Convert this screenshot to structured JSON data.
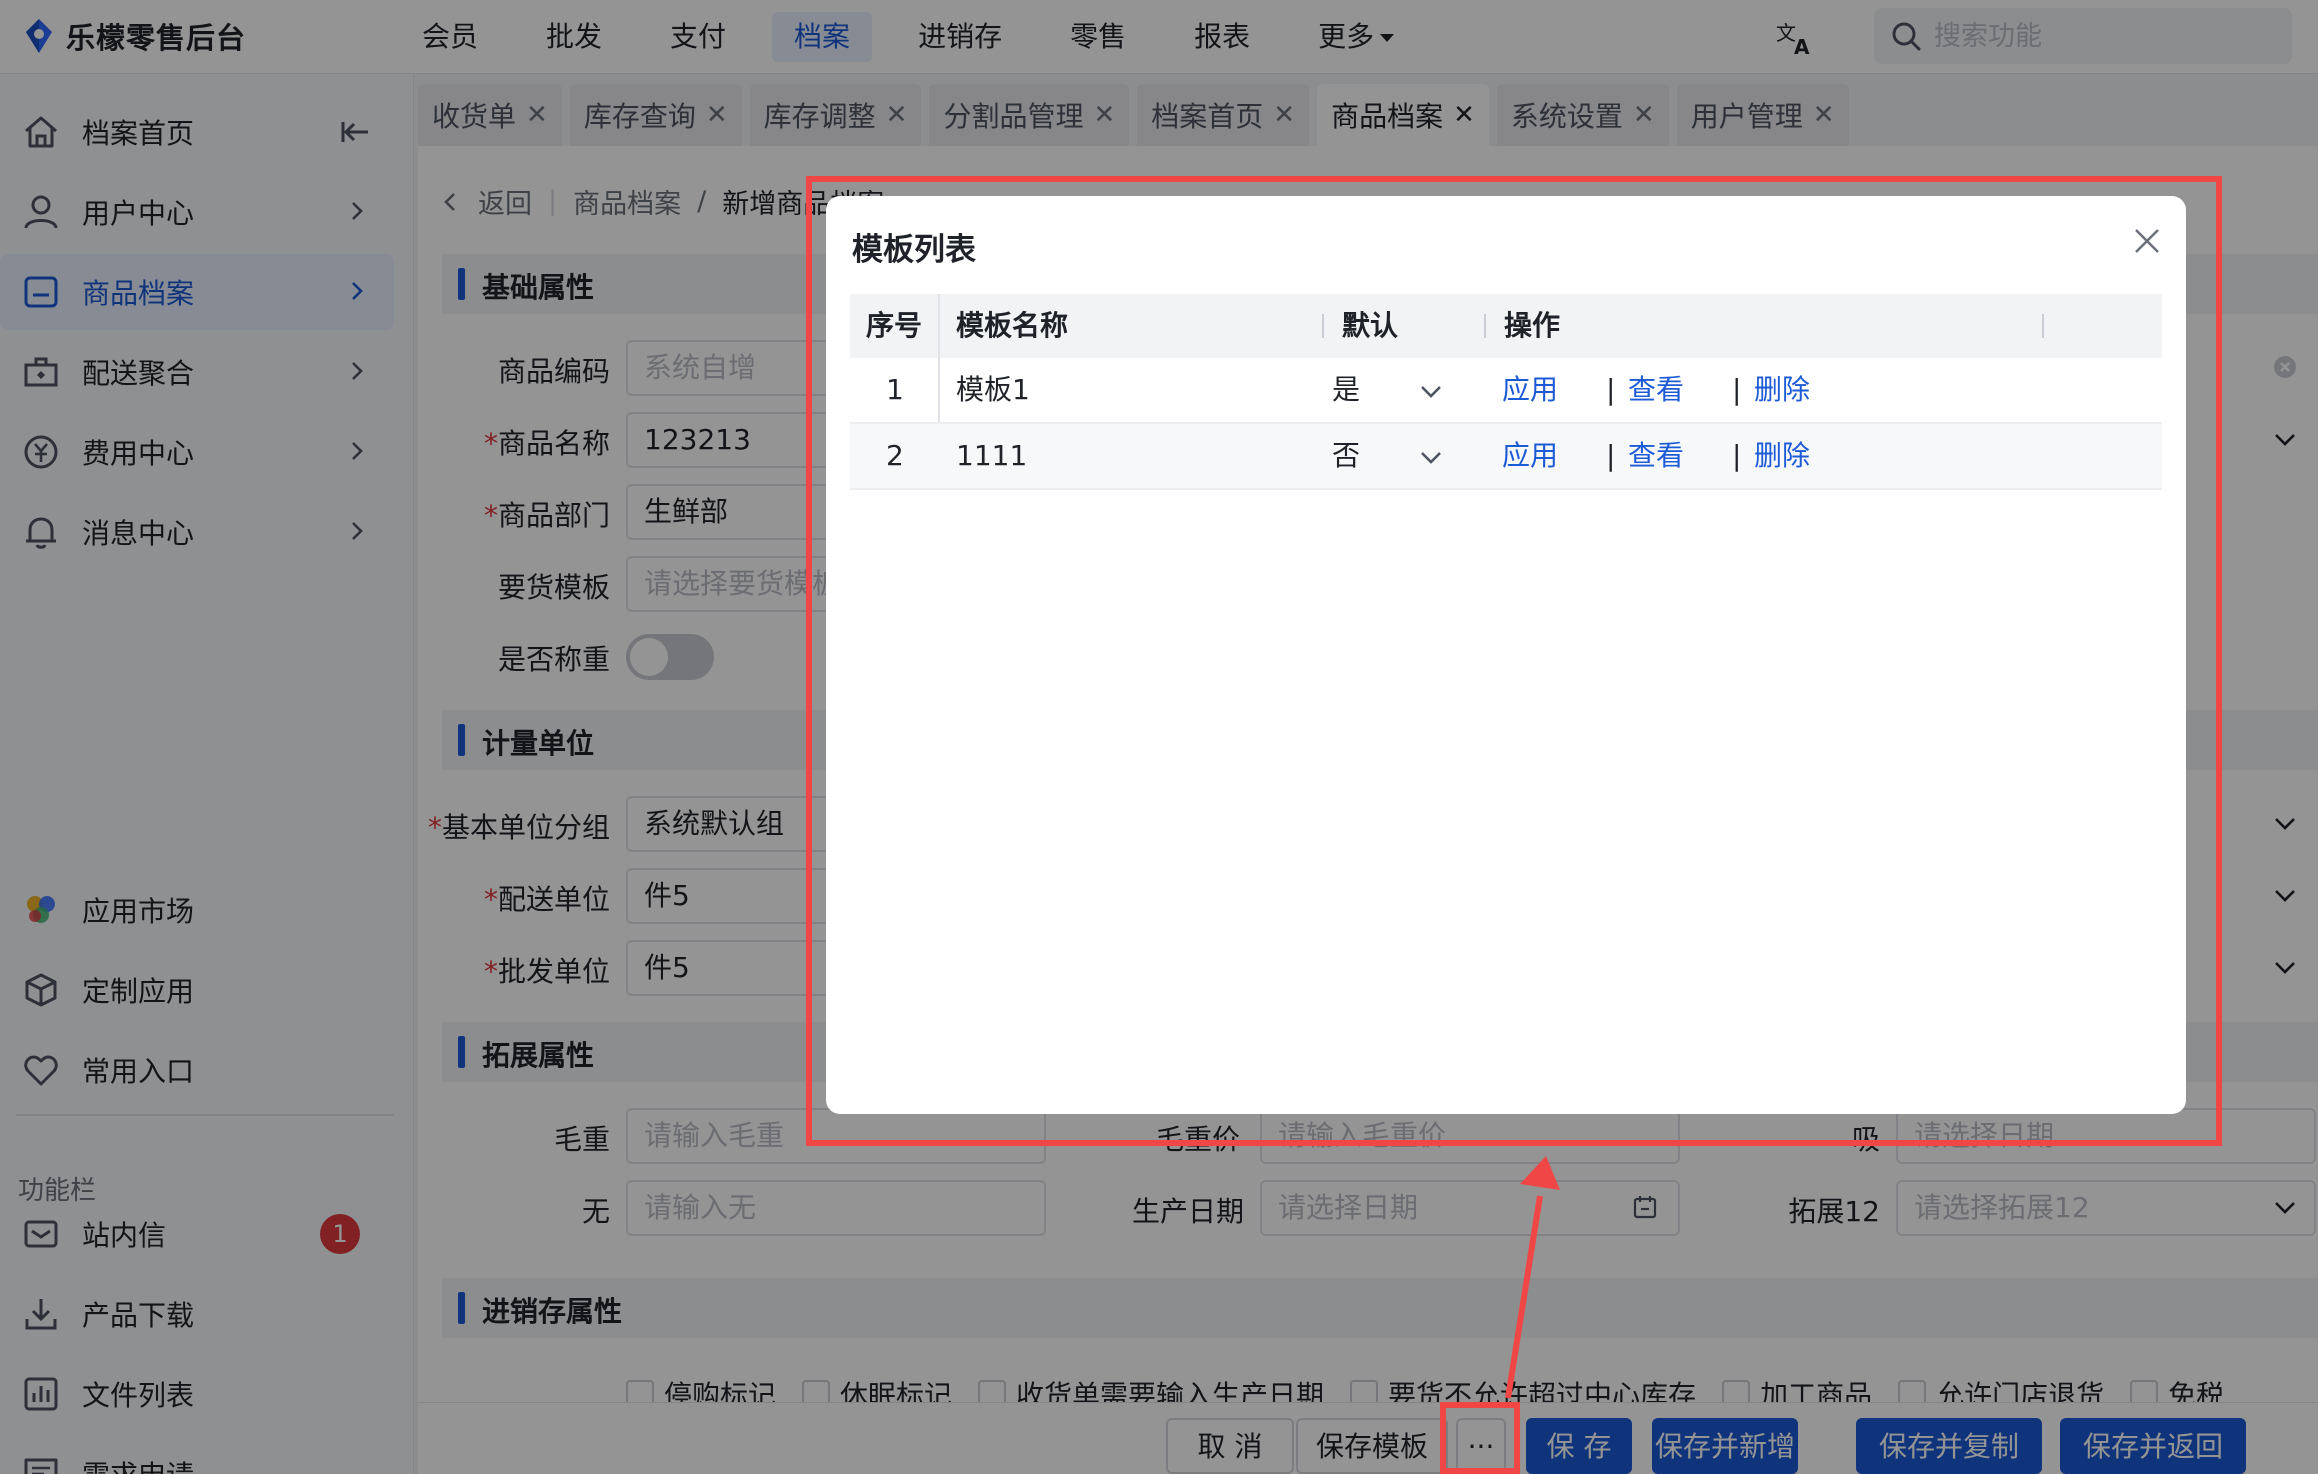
{
  "app": {
    "title": "乐檬零售后台"
  },
  "topnav": {
    "items": [
      "会员",
      "批发",
      "支付",
      "档案",
      "进销存",
      "零售",
      "报表"
    ],
    "active": "档案",
    "more_label": "更多"
  },
  "search": {
    "placeholder": "搜索功能"
  },
  "sidebar": {
    "items": [
      {
        "label": "档案首页",
        "icon": "home-icon"
      },
      {
        "label": "用户中心",
        "icon": "user-icon"
      },
      {
        "label": "商品档案",
        "icon": "product-icon",
        "active": true
      },
      {
        "label": "配送聚合",
        "icon": "delivery-icon"
      },
      {
        "label": "费用中心",
        "icon": "yen-icon"
      },
      {
        "label": "消息中心",
        "icon": "bell-icon"
      }
    ],
    "apps": [
      {
        "label": "应用市场",
        "icon": "app-market-icon"
      },
      {
        "label": "定制应用",
        "icon": "cube-icon"
      },
      {
        "label": "常用入口",
        "icon": "heart-icon"
      }
    ],
    "section_title": "功能栏",
    "tools": [
      {
        "label": "站内信",
        "icon": "mail-icon",
        "badge": "1"
      },
      {
        "label": "产品下载",
        "icon": "download-icon"
      },
      {
        "label": "文件列表",
        "icon": "chart-list-icon"
      },
      {
        "label": "需求申请",
        "icon": "request-icon"
      }
    ]
  },
  "tabs": [
    "收货单",
    "库存查询",
    "库存调整",
    "分割品管理",
    "档案首页",
    "商品档案",
    "系统设置",
    "用户管理"
  ],
  "active_tab": "商品档案",
  "page": {
    "back_label": "返回",
    "breadcrumb_parent": "商品档案",
    "breadcrumb_sep": "/",
    "breadcrumb_current": "新增商品档案",
    "sections": {
      "basic": "基础属性",
      "unit": "计量单位",
      "ext": "拓展属性",
      "inv": "进销存属性"
    },
    "fields": {
      "code_label": "商品编码",
      "code_ph": "系统自增",
      "name_label": "商品名称",
      "name_value": "123213",
      "dept_label": "商品部门",
      "dept_value": "生鲜部",
      "tpl_label": "要货模板",
      "tpl_ph": "请选择要货模板",
      "weigh_label": "是否称重",
      "unitgroup_label": "基本单位分组",
      "unitgroup_value": "系统默认组",
      "deliv_label": "配送单位",
      "deliv_value": "件5",
      "whole_label": "批发单位",
      "whole_value": "件5",
      "gross_label": "毛重",
      "gross_ph": "请输入毛重",
      "grossprice_label": "毛重价",
      "grossprice_ph": "请输入毛重价",
      "x_label": "吸",
      "x_ph": "请选择日期",
      "none_label": "无",
      "none_ph": "请输入无",
      "prod_label": "生产日期",
      "prod_ph": "请选择日期",
      "ext12_label": "拓展12",
      "ext12_ph": "请选择拓展12"
    },
    "required_mark": "*",
    "checkboxes": [
      "停购标记",
      "休眠标记",
      "收货单需要输入生产日期",
      "要货不允许超过中心库存",
      "加工商品",
      "允许门店退货",
      "免税"
    ]
  },
  "footer": {
    "cancel": "取 消",
    "save_template": "保存模板",
    "more": "···",
    "save": "保 存",
    "save_new": "保存并新增",
    "save_copy": "保存并复制",
    "save_back": "保存并返回"
  },
  "modal": {
    "title": "模板列表",
    "columns": [
      "序号",
      "模板名称",
      "默认",
      "操作"
    ],
    "rows": [
      {
        "no": "1",
        "name": "模板1",
        "default": "是"
      },
      {
        "no": "2",
        "name": "1111",
        "default": "否"
      }
    ],
    "actions": {
      "apply": "应用",
      "view": "查看",
      "delete": "删除",
      "sep": "|"
    }
  },
  "colors": {
    "accent": "#1d5bd6",
    "annotation": "#f04646",
    "badge": "#e0393e"
  }
}
